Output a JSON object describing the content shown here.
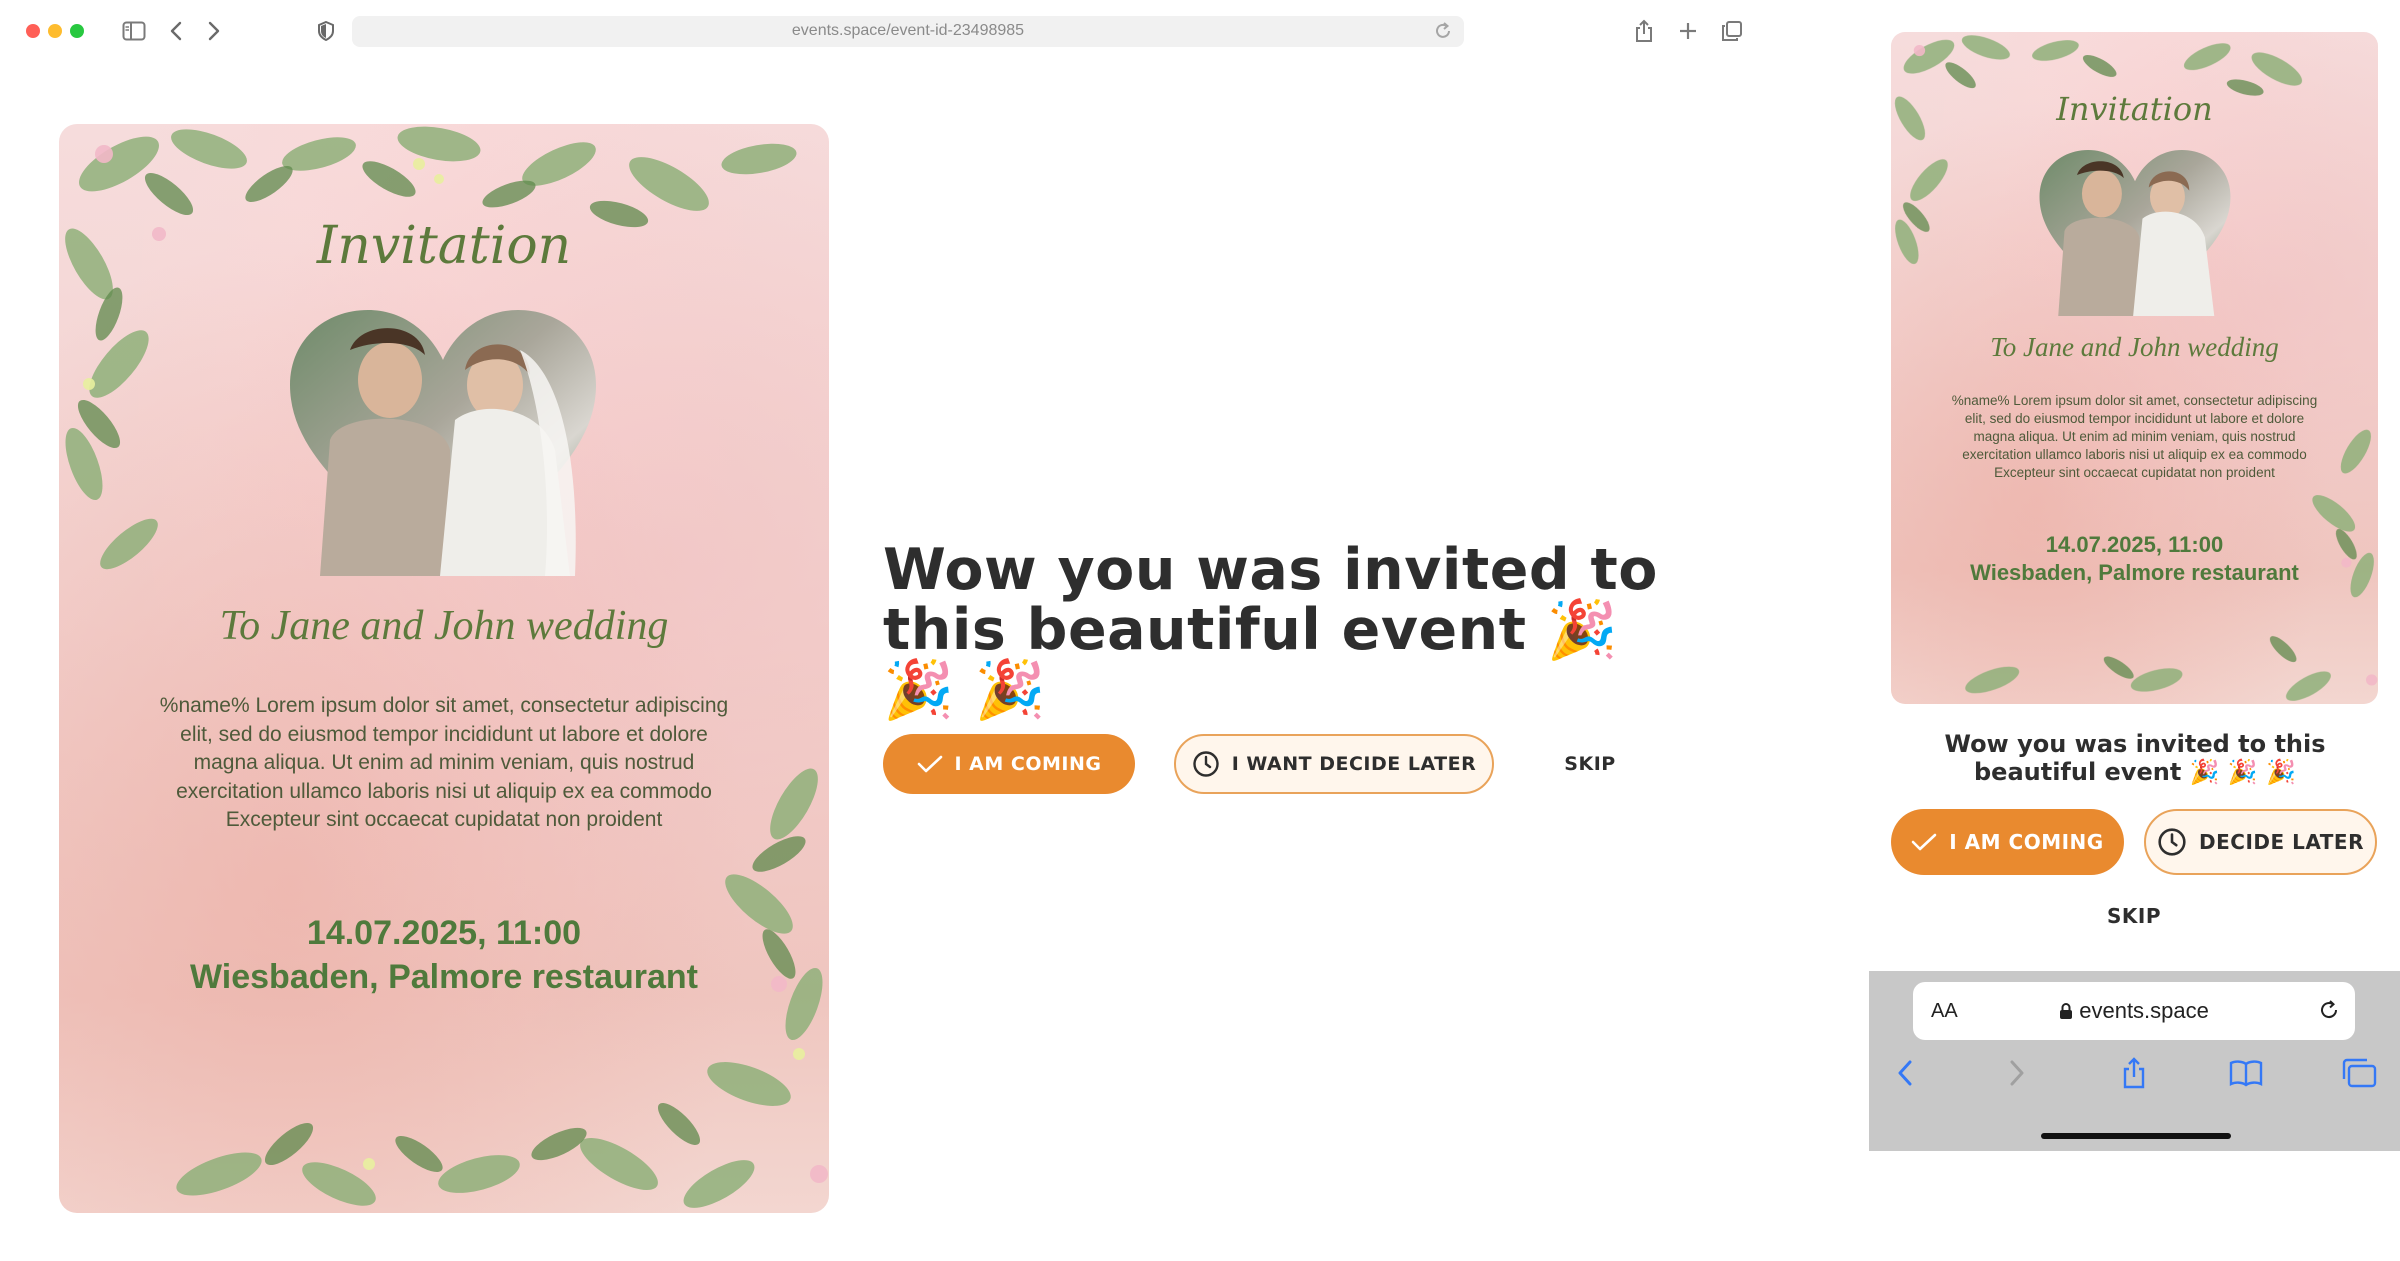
{
  "browser": {
    "url": "events.space/event-id-23498985"
  },
  "invitation": {
    "heading": "Invitation",
    "subtitle": "To Jane and John wedding",
    "body": "%name% Lorem ipsum dolor sit amet, consectetur adipiscing elit, sed do eiusmod tempor incididunt ut labore et dolore magna aliqua. Ut enim ad minim veniam, quis nostrud exercitation ullamco laboris nisi ut aliquip ex ea commodo Excepteur sint occaecat cupidatat non proident",
    "date": "14.07.2025, 11:00",
    "place": "Wiesbaden, Palmore restaurant"
  },
  "main": {
    "title": "Wow you was invited to this beautiful event 🎉 🎉 🎉",
    "coming_label": "I AM COMING",
    "later_label": "I WANT DECIDE LATER",
    "skip_label": "SKIP"
  },
  "mobile": {
    "title": "Wow you was invited to this beautiful event 🎉 🎉 🎉",
    "coming_label": "I AM COMING",
    "later_label": "DECIDE LATER",
    "skip_label": "SKIP",
    "safari": {
      "text_size_label": "AA",
      "host": "events.space"
    }
  },
  "colors": {
    "accent": "#e98a2f",
    "card_green": "#5d7a3c",
    "card_pink": "#f3d2cf"
  }
}
